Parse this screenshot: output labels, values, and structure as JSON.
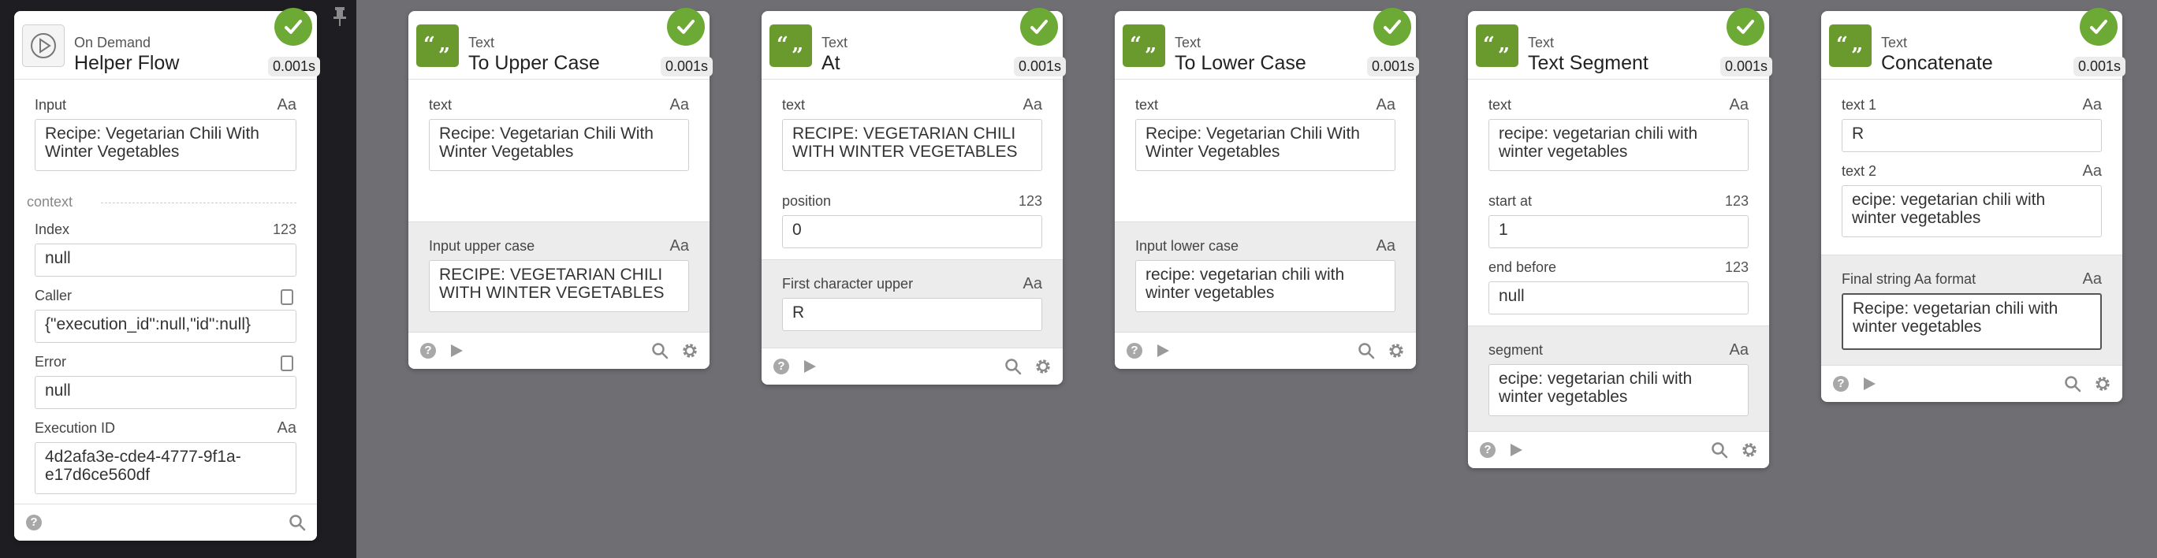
{
  "timing": "0.001s",
  "type_badge": "Aa",
  "number_badge": "123",
  "flow_card": {
    "kind": "On Demand",
    "title": "Helper Flow",
    "input_label": "Input",
    "input_value": "Recipe: Vegetarian Chili With Winter Vegetables",
    "context_label": "context",
    "index_label": "Index",
    "index_value": "null",
    "caller_label": "Caller",
    "caller_value": "{\"execution_id\":null,\"id\":null}",
    "error_label": "Error",
    "error_value": "null",
    "execution_id_label": "Execution ID",
    "execution_id_value": "4d2afa3e-cde4-4777-9f1a-e17d6ce560df"
  },
  "cards": [
    {
      "kind": "Text",
      "title": "To Upper Case",
      "text_label": "text",
      "text_value": "Recipe: Vegetarian Chili With Winter Vegetables",
      "output_label": "Input upper case",
      "output_value": "RECIPE: VEGETARIAN CHILI WITH WINTER VEGETABLES"
    },
    {
      "kind": "Text",
      "title": "At",
      "text_label": "text",
      "text_value": "RECIPE: VEGETARIAN CHILI WITH WINTER VEGETABLES",
      "position_label": "position",
      "position_value": "0",
      "output_label": "First character upper",
      "output_value": "R"
    },
    {
      "kind": "Text",
      "title": "To Lower Case",
      "text_label": "text",
      "text_value": "Recipe: Vegetarian Chili With Winter Vegetables",
      "output_label": "Input lower case",
      "output_value": "recipe: vegetarian chili with winter vegetables"
    },
    {
      "kind": "Text",
      "title": "Text Segment",
      "text_label": "text",
      "text_value": "recipe: vegetarian chili with winter vegetables",
      "start_label": "start at",
      "start_value": "1",
      "end_label": "end before",
      "end_value": "null",
      "output_label": "segment",
      "output_value": "ecipe: vegetarian chili with winter vegetables"
    },
    {
      "kind": "Text",
      "title": "Concatenate",
      "text1_label": "text 1",
      "text1_value": "R",
      "text2_label": "text 2",
      "text2_value": "ecipe: vegetarian chili with winter vegetables",
      "output_label": "Final string Aa format",
      "output_value": "Recipe: vegetarian chili with winter vegetables"
    }
  ],
  "icons": {
    "help": "?",
    "pin": "pin-icon",
    "run": "play-icon",
    "search": "search-icon",
    "settings": "gear-icon"
  },
  "colors": {
    "text_node": "#6a9a2e",
    "success": "#6daa35",
    "canvas": "#6e6e73",
    "sidebar": "#1e1e22"
  }
}
